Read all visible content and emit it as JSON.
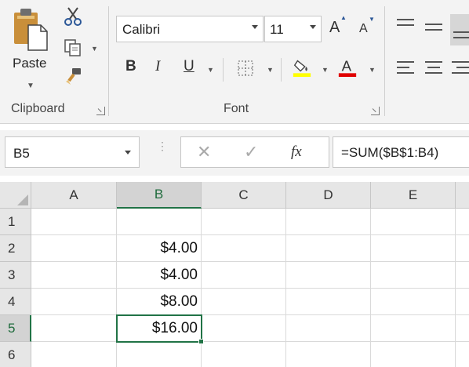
{
  "ribbon": {
    "clipboard": {
      "paste_label": "Paste",
      "group_label": "Clipboard",
      "icons": [
        "paste-icon",
        "cut-icon",
        "copy-icon",
        "format-painter-icon"
      ]
    },
    "font": {
      "font_name": "Calibri",
      "font_size": "11",
      "grow_label": "A",
      "shrink_label": "A",
      "bold_label": "B",
      "italic_label": "I",
      "underline_label": "U",
      "group_label": "Font",
      "fill_color": "#ffff00",
      "font_color": "#e00000"
    }
  },
  "formula_bar": {
    "name_box": "B5",
    "cancel_symbol": "✕",
    "enter_symbol": "✓",
    "fx_label": "fx",
    "formula": "=SUM($B$1:B4)"
  },
  "sheet": {
    "columns": [
      "A",
      "B",
      "C",
      "D",
      "E"
    ],
    "rows": [
      "1",
      "2",
      "3",
      "4",
      "5",
      "6"
    ],
    "selected_column": "B",
    "selected_row": "5",
    "cells": {
      "B2": "$4.00",
      "B3": "$4.00",
      "B4": "$8.00",
      "B5": "$16.00"
    },
    "accent_color": "#217346"
  }
}
